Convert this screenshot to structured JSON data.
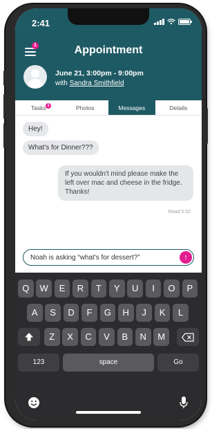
{
  "status_bar": {
    "time": "2:41"
  },
  "header": {
    "title": "Appointment",
    "menu_badge": "1",
    "appointment_date": "June 21, 3:00pm - 9:00pm",
    "with_prefix": "with",
    "with_name": "Sandra Smithfield"
  },
  "tabs": [
    {
      "label": "Tasks",
      "badge": "1"
    },
    {
      "label": "Photos"
    },
    {
      "label": "Messages",
      "active": true
    },
    {
      "label": "Details"
    }
  ],
  "messages": [
    {
      "from": "them",
      "text": "Hey!"
    },
    {
      "from": "them",
      "text": "What's for Dinner???"
    },
    {
      "from": "me",
      "text": "If you wouldn't mind please make the left over mac and cheese in the fridge. Thanks!"
    }
  ],
  "read_receipt": "Read 5:52",
  "composer": {
    "value": "Noah is asking “what's for dessert?”",
    "send_icon": "arrow-up-icon"
  },
  "keyboard": {
    "row1": [
      "Q",
      "W",
      "E",
      "R",
      "T",
      "Y",
      "U",
      "I",
      "O",
      "P"
    ],
    "row2": [
      "A",
      "S",
      "D",
      "F",
      "G",
      "H",
      "J",
      "K",
      "L"
    ],
    "row3": [
      "Z",
      "X",
      "C",
      "V",
      "B",
      "N",
      "M"
    ],
    "numbers_key": "123",
    "space_key": "space",
    "go_key": "Go",
    "shift_icon": "shift-icon",
    "backspace_icon": "backspace-icon",
    "emoji_icon": "emoji-icon",
    "mic_icon": "microphone-icon"
  },
  "colors": {
    "header": "#1e5a64",
    "accent": "#e31c8e",
    "keyboard": "#2c2c2e"
  }
}
